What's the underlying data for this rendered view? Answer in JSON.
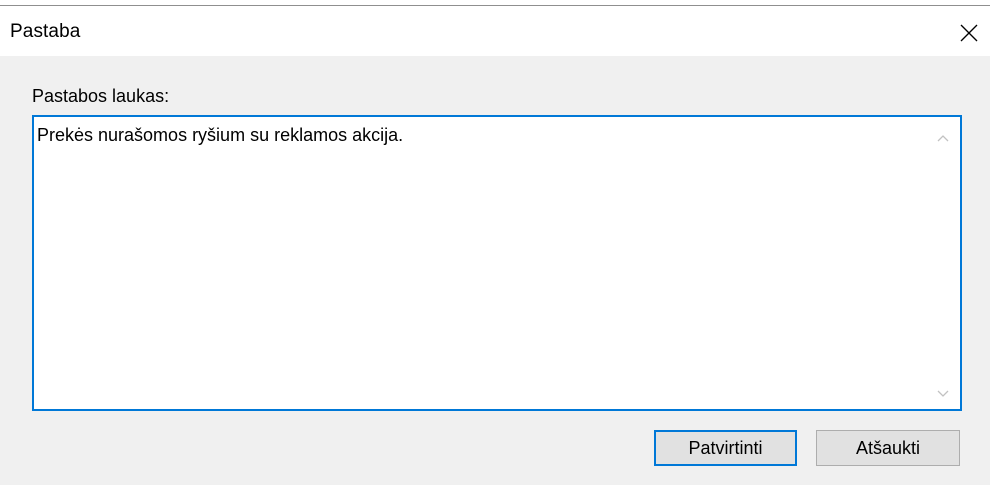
{
  "window": {
    "title": "Pastaba"
  },
  "icons": {
    "close": "close-icon",
    "scroll_up": "chevron-up-icon",
    "scroll_down": "chevron-down-icon"
  },
  "note": {
    "label": "Pastabos laukas:",
    "value": "Prekės nurašomos ryšium su reklamos akcija."
  },
  "buttons": {
    "confirm_label": "Patvirtinti",
    "cancel_label": "Atšaukti"
  },
  "colors": {
    "accent": "#0078d7",
    "dialog_background": "#f0f0f0",
    "button_background": "#e1e1e1"
  }
}
